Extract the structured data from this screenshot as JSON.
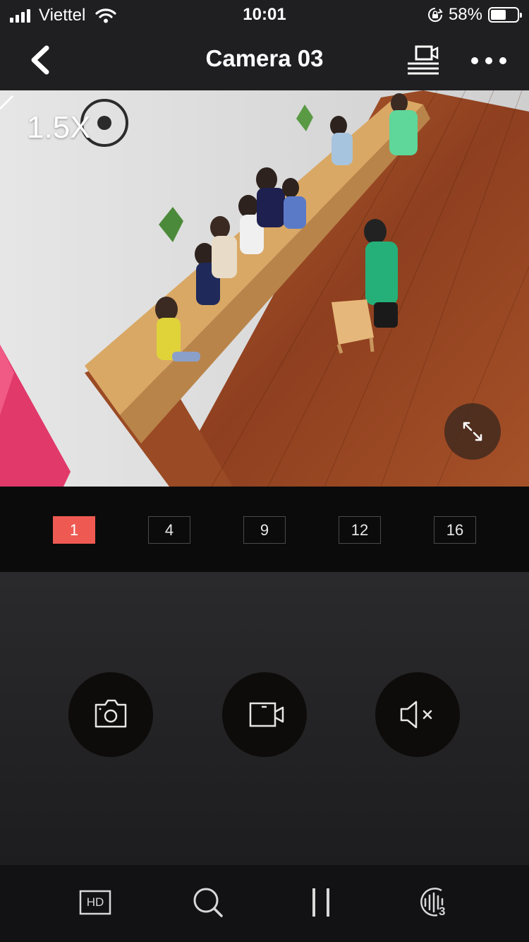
{
  "status_bar": {
    "carrier": "Viettel",
    "time": "10:01",
    "battery_percent": "58%",
    "battery_level": 0.58,
    "icons": [
      "signal-icon",
      "wifi-icon",
      "rotation-lock-icon",
      "battery-icon"
    ]
  },
  "nav": {
    "title": "Camera 03",
    "icons": [
      "back-chevron-icon",
      "cast-screen-icon",
      "more-dots-icon"
    ]
  },
  "video": {
    "zoom_label": "1.5X",
    "icons": [
      "fullscreen-expand-icon"
    ]
  },
  "layout_selector": {
    "options": [
      "1",
      "4",
      "9",
      "12",
      "16"
    ],
    "selected": "1",
    "active_color": "#ee5a52"
  },
  "controls": {
    "icons": [
      "camera-snapshot-icon",
      "record-video-icon",
      "speaker-muted-icon"
    ]
  },
  "toolbar": {
    "hd_label": "HD",
    "stream_badge": "3",
    "icons": [
      "hd-quality-icon",
      "search-icon",
      "pause-icon",
      "voice-stream-icon"
    ]
  }
}
